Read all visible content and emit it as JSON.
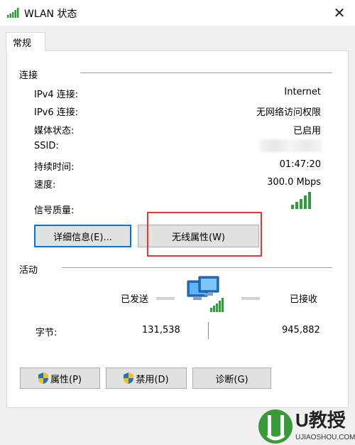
{
  "window": {
    "title": "WLAN 状态",
    "close_glyph": "✕"
  },
  "tabs": [
    {
      "label": "常规",
      "active": true
    }
  ],
  "connection": {
    "section_title": "连接",
    "rows": [
      {
        "label": "IPv4 连接:",
        "value": "Internet"
      },
      {
        "label": "IPv6 连接:",
        "value": "无网络访问权限"
      },
      {
        "label": "媒体状态:",
        "value": "已启用"
      },
      {
        "label": "SSID:",
        "value": ""
      },
      {
        "label": "持续时间:",
        "value": "01:47:20"
      },
      {
        "label": "速度:",
        "value": "300.0 Mbps"
      }
    ],
    "signal_label": "信号质量:",
    "signal_bars_active": 5,
    "signal_bars_total": 5
  },
  "buttons_top": {
    "details": "详细信息(E)...",
    "wireless_properties": "无线属性(W)"
  },
  "activity": {
    "section_title": "活动",
    "sent_label": "已发送",
    "received_label": "已接收",
    "bytes_label": "字节:",
    "bytes_sent": "131,538",
    "bytes_received": "945,882"
  },
  "buttons_bottom": {
    "properties": "属性(P)",
    "disable": "禁用(D)",
    "diagnose": "诊断(G)"
  },
  "colors": {
    "accent_blue": "#0078d7",
    "signal_green": "#2e9e3a",
    "highlight_red": "#e53935",
    "watermark_green": "#3a9a3a"
  },
  "watermark": {
    "brand": "U教授",
    "url": "UJIAOSHOU.COM"
  }
}
